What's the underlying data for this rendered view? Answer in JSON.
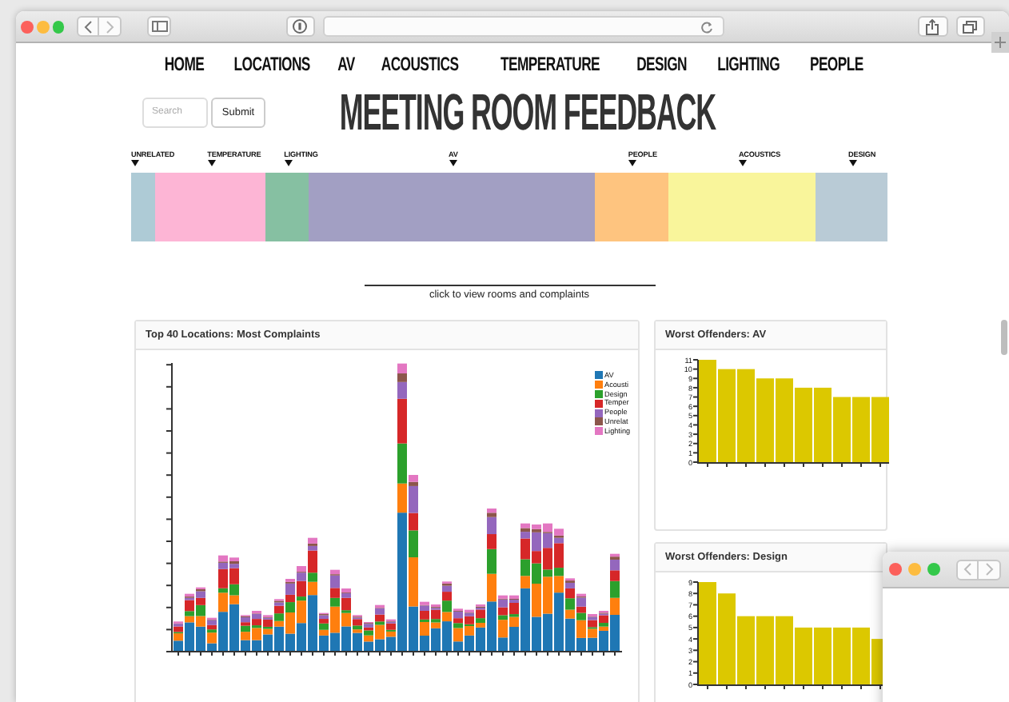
{
  "nav": [
    "HOME",
    "LOCATIONS",
    "AV",
    "ACOUSTICS",
    "TEMPERATURE",
    "DESIGN",
    "LIGHTING",
    "PEOPLE"
  ],
  "search": {
    "placeholder": "Search"
  },
  "submit_button": "Submit",
  "title": "MEETING ROOM FEEDBACK",
  "strip": {
    "segments": [
      {
        "label": "UNRELATED",
        "color": "#aecbd6"
      },
      {
        "label": "TEMPERATURE",
        "color": "#fdb5d5"
      },
      {
        "label": "LIGHTING",
        "color": "#86c0a2"
      },
      {
        "label": "AV",
        "color": "#a29fc3"
      },
      {
        "label": "PEOPLE",
        "color": "#fec47f"
      },
      {
        "label": "ACOUSTICS",
        "color": "#f9f59b"
      },
      {
        "label": "DESIGN",
        "color": "#b9cbd6"
      }
    ]
  },
  "caption": "click to view rooms and complaints",
  "panels": [
    {
      "kind": "stacked",
      "title": "Top 40 Locations: Most Complaints",
      "legend": [
        {
          "label": "AV",
          "color": "#1f77b4"
        },
        {
          "label": "Acousti",
          "color": "#ff7f0e"
        },
        {
          "label": "Design",
          "color": "#2ca02c"
        },
        {
          "label": "Temper",
          "color": "#d62728"
        },
        {
          "label": "People",
          "color": "#9467bd"
        },
        {
          "label": "Unrelat",
          "color": "#8c564b"
        },
        {
          "label": "Lighting",
          "color": "#e377c2"
        }
      ]
    },
    {
      "kind": "bar",
      "title": "Worst Offenders: AV",
      "chart_data": {
        "type": "bar",
        "ylim": [
          0,
          11
        ],
        "yticks": [
          0,
          1,
          2,
          3,
          4,
          5,
          6,
          7,
          8,
          9,
          10,
          11
        ],
        "values": [
          11,
          10,
          10,
          9,
          9,
          8,
          8,
          7,
          7,
          7
        ]
      }
    },
    {
      "kind": "bar",
      "title": "Worst Offenders: Design",
      "chart_data": {
        "type": "bar",
        "ylim": [
          0,
          9
        ],
        "yticks": [
          0,
          1,
          2,
          3,
          4,
          5,
          6,
          7,
          8,
          9
        ],
        "values": [
          9,
          8,
          6,
          6,
          6,
          5,
          5,
          5,
          5,
          4
        ]
      }
    }
  ]
}
